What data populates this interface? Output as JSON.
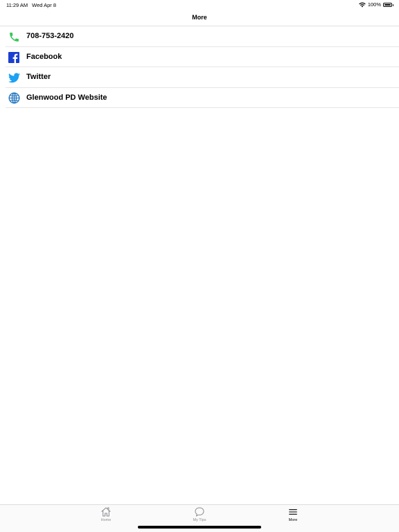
{
  "status_bar": {
    "time": "11:29 AM",
    "date": "Wed Apr 8",
    "battery": "100%"
  },
  "nav": {
    "title": "More"
  },
  "list": {
    "items": [
      {
        "label": "708-753-2420",
        "icon": "phone-icon",
        "color": "#34c759"
      },
      {
        "label": "Facebook",
        "icon": "facebook-icon",
        "color": "#1877f2"
      },
      {
        "label": "Twitter",
        "icon": "twitter-icon",
        "color": "#1da1f2"
      },
      {
        "label": "Glenwood PD Website",
        "icon": "globe-icon",
        "color": "#1e73be"
      }
    ]
  },
  "tabs": {
    "home": "Home",
    "my_tips": "My Tips",
    "more": "More"
  }
}
